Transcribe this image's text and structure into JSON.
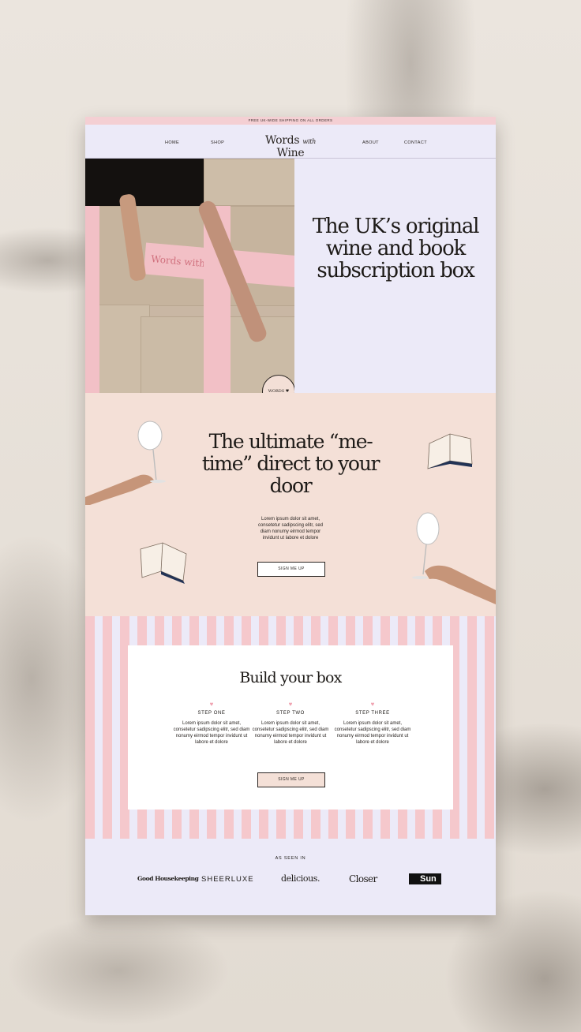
{
  "topbar": {
    "text": "FREE UK-WIDE SHIPPING ON ALL ORDERS"
  },
  "nav": {
    "home": "HOME",
    "shop": "SHOP",
    "logo_main_1": "Words",
    "logo_with": "with",
    "logo_main_2": "Wine",
    "about": "ABOUT",
    "contact": "CONTACT"
  },
  "hero": {
    "headline": "The UK’s original wine and book subscription box",
    "tape_text": "Words with Wine",
    "seal_text": "WORDS ♥ WINE"
  },
  "metime": {
    "headline": "The ultimate “me-time” direct to your door",
    "body": "Lorem ipsum dolor sit amet, consetetur sadipscing elitr, sed diam nonumy eirmod tempor invidunt ut labore et dolore",
    "button": "SIGN ME UP"
  },
  "build": {
    "title": "Build your box",
    "steps": [
      {
        "title": "STEP ONE",
        "body": "Lorem ipsum dolor sit amet, consetetur sadipscing elitr, sed diam nonumy eirmod tempor invidunt ut labore et dolore"
      },
      {
        "title": "STEP TWO",
        "body": "Lorem ipsum dolor sit amet, consetetur sadipscing elitr, sed diam nonumy eirmod tempor invidunt ut labore et dolore"
      },
      {
        "title": "STEP THREE",
        "body": "Lorem ipsum dolor sit amet, consetetur sadipscing elitr, sed diam nonumy eirmod tempor invidunt ut labore et dolore"
      }
    ],
    "button": "SIGN ME UP"
  },
  "seen_in": {
    "label": "AS SEEN IN",
    "logos": [
      "Good Housekeeping",
      "SHEERLUXE",
      "delicious.",
      "Closer",
      "Sun"
    ]
  },
  "colors": {
    "pink": "#f4cfd3",
    "lavender": "#eceaf8",
    "peach": "#f4e0d7",
    "stripe_pink": "#f5c8cc"
  }
}
